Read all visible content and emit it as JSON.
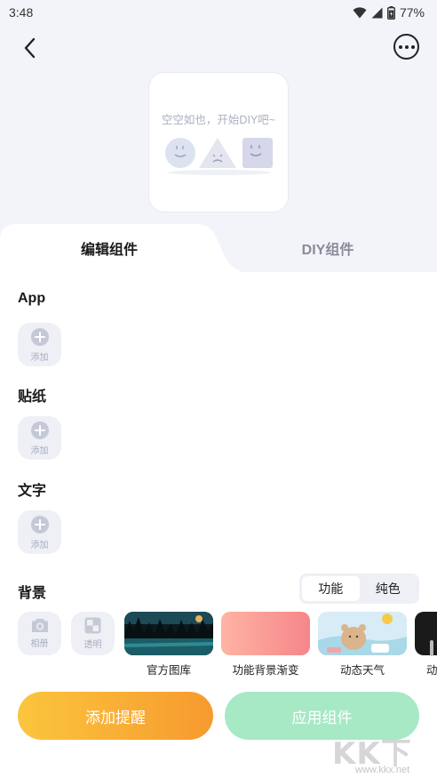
{
  "status_bar": {
    "time": "3:48",
    "battery": "77%"
  },
  "preview": {
    "empty_text": "空空如也，开始DIY吧~"
  },
  "tabs": [
    {
      "label": "编辑组件"
    },
    {
      "label": "DIY组件"
    }
  ],
  "sections": {
    "app": {
      "title": "App",
      "add_label": "添加"
    },
    "sticker": {
      "title": "贴纸",
      "add_label": "添加"
    },
    "text": {
      "title": "文字",
      "add_label": "添加"
    },
    "background": {
      "title": "背景",
      "segments": [
        "功能",
        "纯色"
      ],
      "selected_segment": "功能",
      "tools": [
        {
          "label": "相册",
          "icon": "camera-icon"
        },
        {
          "label": "透明",
          "icon": "transparent-icon"
        }
      ],
      "thumbnails": [
        {
          "label": "官方图库"
        },
        {
          "label": "功能背景渐变"
        },
        {
          "label": "动态天气"
        },
        {
          "label": "动"
        }
      ]
    }
  },
  "buttons": {
    "remind": "添加提醒",
    "apply": "应用组件"
  },
  "watermark": {
    "main": "KK下载",
    "url": "www.kkx.net"
  },
  "colors": {
    "accent_orange": "#f79a2f",
    "accent_yellow": "#fbc53d",
    "apply_green": "#a7e8c5",
    "background": "#f3f4f9"
  }
}
